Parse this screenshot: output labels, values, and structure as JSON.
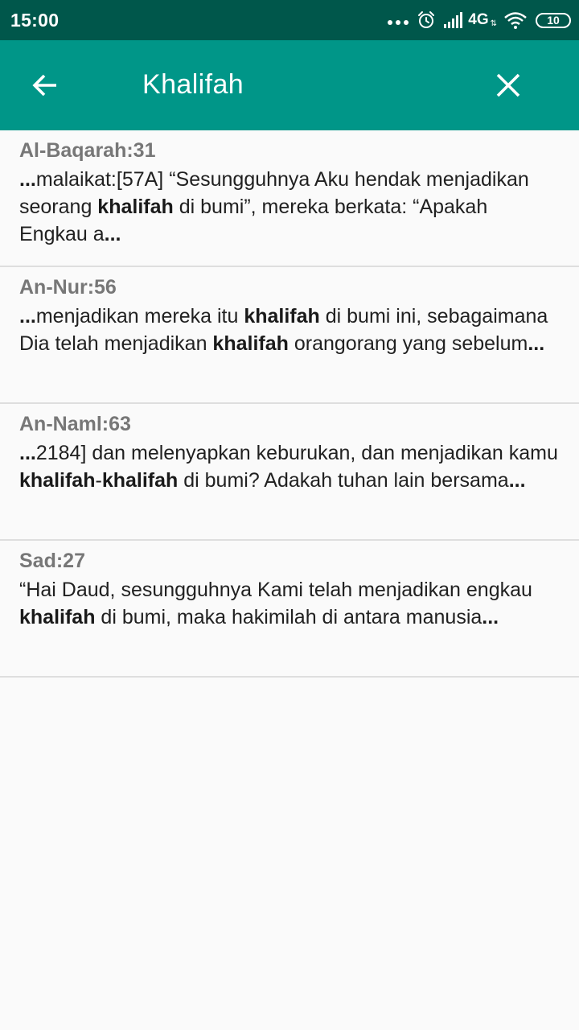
{
  "status_bar": {
    "time": "15:00",
    "network": "4G",
    "battery": "10",
    "icons": [
      "more-dots-icon",
      "alarm-icon",
      "signal-icon",
      "wifi-icon",
      "battery-icon"
    ]
  },
  "toolbar": {
    "back_icon": "arrow-left-icon",
    "search_query": "Khalifah",
    "close_icon": "close-icon",
    "background": "#009688",
    "status_background": "#00574b"
  },
  "results": [
    {
      "ref": "Al-Baqarah:31",
      "snippet": [
        {
          "text": "...",
          "bold": true
        },
        {
          "text": "malaikat:[57A] “Sesungguhnya Aku hendak menjadikan seorang ",
          "bold": false
        },
        {
          "text": "khalifah",
          "bold": true
        },
        {
          "text": " di bumi”, mereka berkata: “Apakah Engkau a",
          "bold": false
        },
        {
          "text": "...",
          "bold": true
        }
      ]
    },
    {
      "ref": "An-Nur:56",
      "snippet": [
        {
          "text": "...",
          "bold": true
        },
        {
          "text": "menjadikan mereka itu ",
          "bold": false
        },
        {
          "text": "khalifah",
          "bold": true
        },
        {
          "text": " di bumi ini, sebagaimana Dia telah menjadikan ",
          "bold": false
        },
        {
          "text": "khalifah",
          "bold": true
        },
        {
          "text": " orangorang yang sebelum",
          "bold": false
        },
        {
          "text": "...",
          "bold": true
        }
      ]
    },
    {
      "ref": "An-Naml:63",
      "snippet": [
        {
          "text": "...",
          "bold": true
        },
        {
          "text": "2184] dan melenyapkan keburukan, dan menjadikan kamu ",
          "bold": false
        },
        {
          "text": "khalifah",
          "bold": true
        },
        {
          "text": "-",
          "bold": false
        },
        {
          "text": "khalifah",
          "bold": true
        },
        {
          "text": " di bumi? Adakah tuhan lain bersama",
          "bold": false
        },
        {
          "text": "...",
          "bold": true
        }
      ]
    },
    {
      "ref": "Sad:27",
      "snippet": [
        {
          "text": "“Hai Daud, sesungguhnya Kami telah menjadikan engkau ",
          "bold": false
        },
        {
          "text": "khalifah",
          "bold": true
        },
        {
          "text": " di bumi, maka hakimilah di antara manusia",
          "bold": false
        },
        {
          "text": "...",
          "bold": true
        }
      ]
    }
  ]
}
